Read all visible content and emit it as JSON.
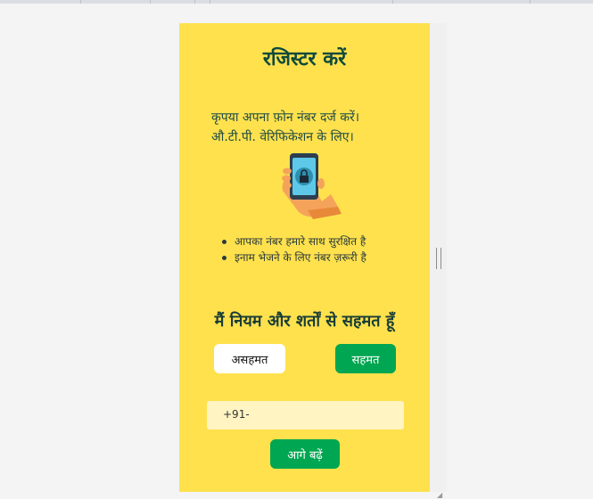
{
  "register": {
    "title": "रजिस्टर करें",
    "instruction_line1": "कृपया अपना फ़ोन नंबर दर्ज करें।",
    "instruction_line2": "औ.टी.पी. वेरिफिकेशन के लिए।",
    "bullets": [
      "आपका नंबर हमारे साथ सुरक्षित है",
      "इनाम भेजने के लिए नंबर ज़रूरी है"
    ],
    "illustration_icon": "phone-lock-icon"
  },
  "terms": {
    "heading": "मैं नियम और शर्तों से सहमत हूँ",
    "disagree_label": "असहमत",
    "agree_label": "सहमत"
  },
  "phone_input": {
    "prefix": "+91-",
    "value": ""
  },
  "next_label": "आगे बढ़ें",
  "colors": {
    "background": "#ffe14d",
    "accent": "#00a651",
    "heading": "#0f4a3c",
    "input_bg": "#fff4c2"
  }
}
